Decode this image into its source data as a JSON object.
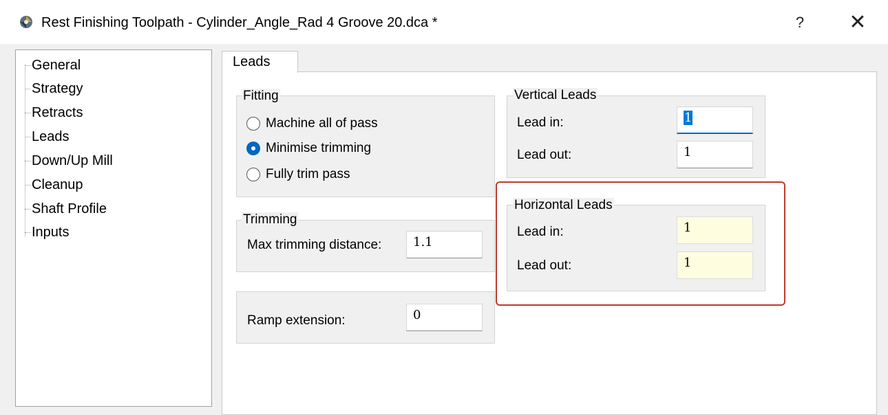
{
  "window": {
    "title": "Rest Finishing Toolpath - Cylinder_Angle_Rad 4 Groove 20.dca *",
    "help_label": "?",
    "close_label": "✕"
  },
  "tree": {
    "items": [
      {
        "label": "General"
      },
      {
        "label": "Strategy"
      },
      {
        "label": "Retracts"
      },
      {
        "label": "Leads"
      },
      {
        "label": "Down/Up Mill"
      },
      {
        "label": "Cleanup"
      },
      {
        "label": "Shaft Profile"
      },
      {
        "label": "Inputs"
      }
    ]
  },
  "tab": {
    "label": "Leads"
  },
  "fitting": {
    "title": "Fitting",
    "options": [
      {
        "label": "Machine all of pass",
        "checked": false
      },
      {
        "label": "Minimise trimming",
        "checked": true
      },
      {
        "label": "Fully trim pass",
        "checked": false
      }
    ]
  },
  "trimming": {
    "title": "Trimming",
    "max_label": "Max trimming distance:",
    "max_value": "1.1"
  },
  "ramp": {
    "label": "Ramp extension:",
    "value": "0"
  },
  "vertical_leads": {
    "title": "Vertical Leads",
    "lead_in_label": "Lead in:",
    "lead_in_value": "1",
    "lead_out_label": "Lead out:",
    "lead_out_value": "1"
  },
  "horizontal_leads": {
    "title": "Horizontal Leads",
    "lead_in_label": "Lead in:",
    "lead_in_value": "1",
    "lead_out_label": "Lead out:",
    "lead_out_value": "1"
  },
  "colors": {
    "accent": "#0067c0",
    "highlight_border": "#c0392b",
    "input_highlight": "#fffde0"
  }
}
